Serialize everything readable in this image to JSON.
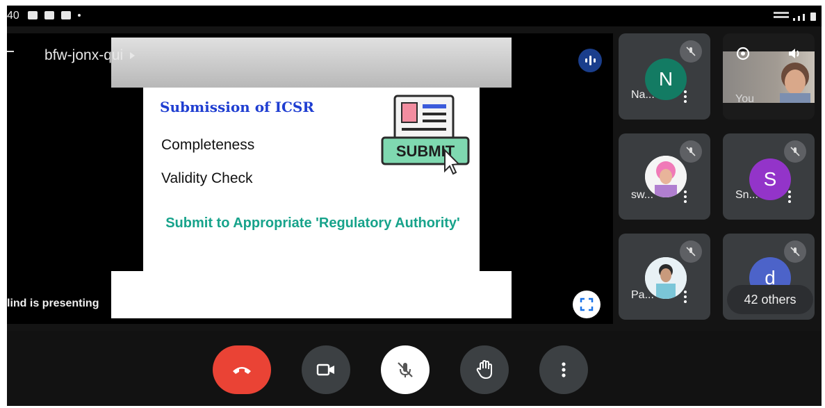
{
  "status_bar": {
    "time": "40"
  },
  "meeting": {
    "code": "bfw-jonx-qui",
    "presenting_text": "lind is presenting"
  },
  "slide": {
    "heading": "Submission of ICSR",
    "items": [
      "Completeness",
      "Validity Check"
    ],
    "submit_text": "Submit to Appropriate 'Regulatory Authority'",
    "art_label": "SUBMIT"
  },
  "participants": [
    {
      "name": "Na...",
      "initial": "N",
      "avatar_color": "#137b63",
      "muted": true
    },
    {
      "name": "You",
      "self_view": true
    },
    {
      "name": "sw...",
      "photo": true,
      "muted": true
    },
    {
      "name": "Sn...",
      "initial": "S",
      "avatar_color": "#9334c9",
      "muted": true
    },
    {
      "name": "Pa...",
      "photo": true,
      "muted": true
    },
    {
      "name": "d",
      "initial": "d",
      "avatar_color": "#4c63c9",
      "muted": true
    }
  ],
  "others_count_label": "42 others",
  "icons": {
    "audio": "audio-level-icon",
    "fullscreen": "fullscreen-icon",
    "end_call": "end-call-icon",
    "camera": "camera-icon",
    "mic_off": "mic-off-icon",
    "raise_hand": "raise-hand-icon",
    "more": "more-options-icon"
  },
  "colors": {
    "end_call": "#ea4335",
    "heading_blue": "#1f3ed1",
    "submit_teal": "#17a38b",
    "accent_blue": "#1a3e8c"
  }
}
